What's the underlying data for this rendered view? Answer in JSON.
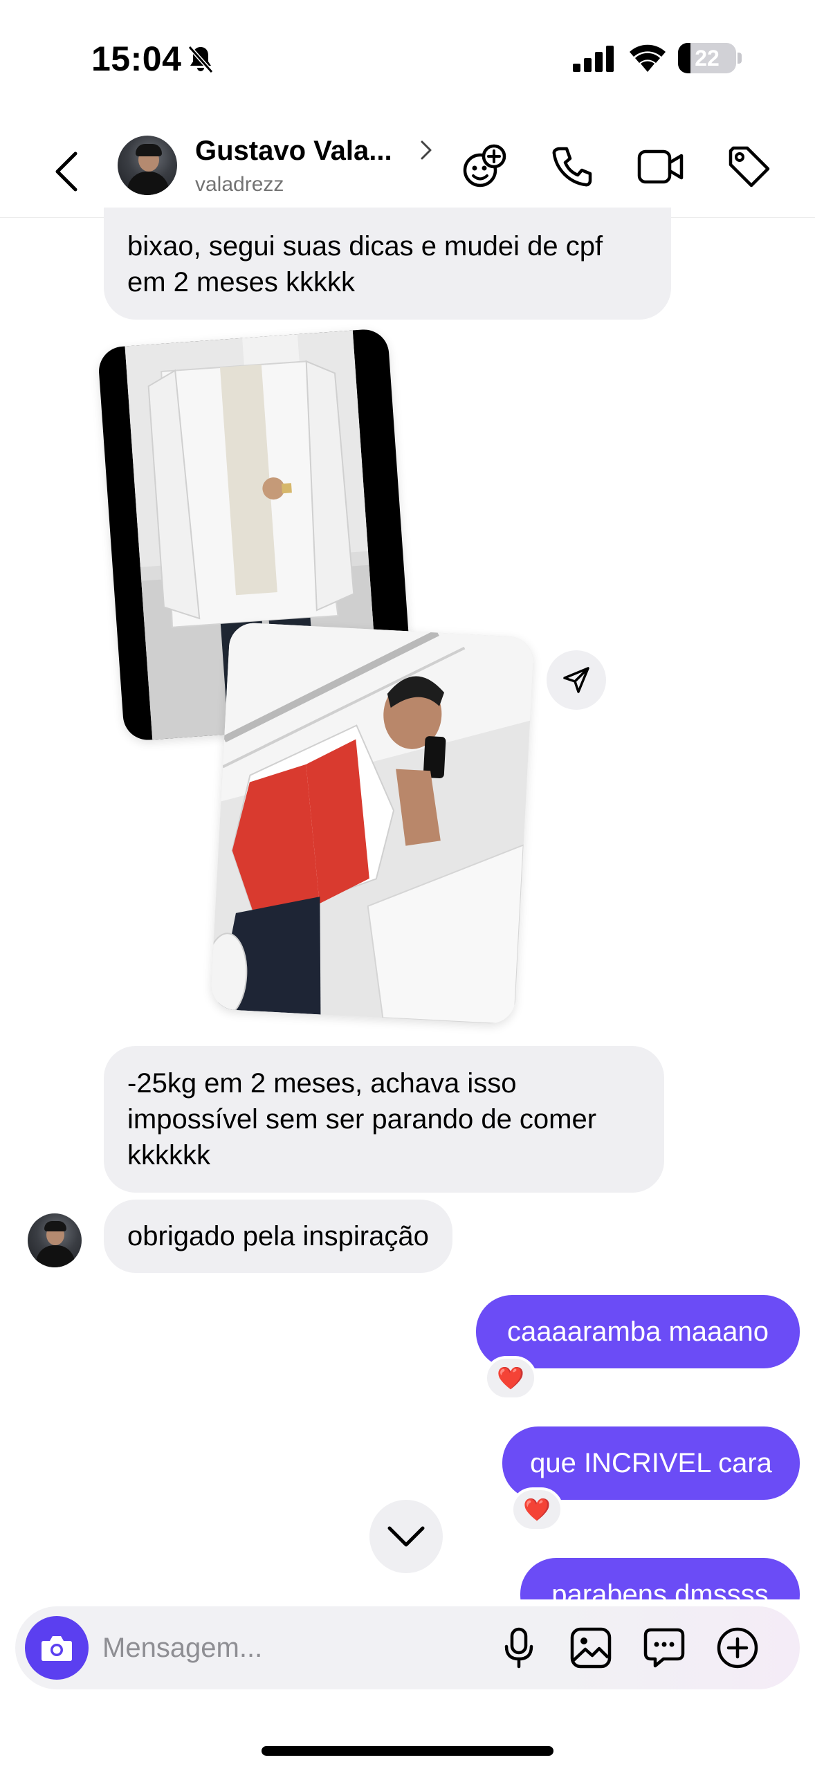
{
  "status_bar": {
    "time": "15:04",
    "battery": "22",
    "icons": [
      "bell-slash-icon",
      "signal-icon",
      "wifi-icon",
      "battery-icon"
    ]
  },
  "header": {
    "name": "Gustavo Vala...",
    "username": "valadrezz",
    "icons": [
      "back-icon",
      "chevron-right-icon",
      "effects-icon",
      "phone-icon",
      "video-icon",
      "tag-icon"
    ]
  },
  "messages": {
    "m1": "bixao, segui suas dicas e mudei de cpf em 2 meses kkkkk",
    "m2": "-25kg em 2 meses, achava isso impossível sem ser parando de comer kkkkkk",
    "m3": "obrigado pela inspiração",
    "m4": "caaaaramba maaano",
    "m5": "que INCRIVEL cara",
    "m6": "parabens dmssss",
    "reaction": "❤️"
  },
  "photos": [
    {
      "description": "before-photo"
    },
    {
      "description": "after-photo"
    }
  ],
  "composer": {
    "placeholder": "Mensagem...",
    "icons": [
      "camera-icon",
      "microphone-icon",
      "gallery-icon",
      "sticker-icon",
      "plus-icon"
    ]
  },
  "colors": {
    "outgoing_bubble": "#6b4cf6",
    "incoming_bubble": "#efeff2",
    "camera_button": "#5b3ff0"
  }
}
